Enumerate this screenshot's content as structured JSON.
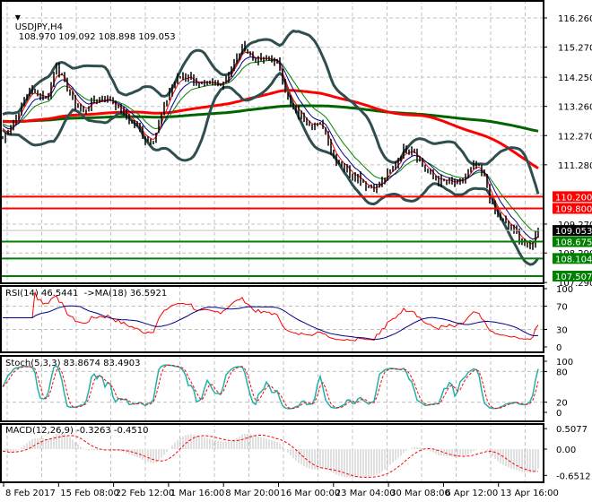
{
  "header": {
    "symbol": "USDJPY,H4",
    "ohlc": "108.970 109.092 108.898 109.053"
  },
  "chart_data": {
    "type": "line",
    "title": "USDJPY,H4 108.970 109.092 108.898 109.053",
    "price_ticks": [
      "116.260",
      "115.270",
      "114.250",
      "113.260",
      "112.270",
      "111.280",
      "109.270",
      "108.290",
      "107.290"
    ],
    "ylim": [
      107.0,
      116.6
    ],
    "time_ticks": [
      "8 Feb 2017",
      "15 Feb 08:00",
      "22 Feb 12:00",
      "1 Mar 16:00",
      "8 Mar 20:00",
      "16 Mar 00:00",
      "23 Mar 04:00",
      "30 Mar 08:00",
      "6 Apr 12:00",
      "13 Apr 16:00"
    ],
    "close_approx": [
      112.16,
      112.6,
      113.2,
      113.83,
      113.7,
      113.52,
      114.74,
      114.0,
      113.4,
      113.07,
      113.4,
      113.52,
      113.52,
      113.2,
      112.9,
      112.6,
      112.15,
      112.2,
      113.2,
      114.0,
      114.3,
      114.3,
      113.98,
      113.98,
      113.98,
      114.2,
      114.74,
      115.35,
      114.9,
      114.8,
      114.9,
      114.6,
      113.4,
      113.0,
      112.8,
      112.6,
      112.6,
      111.6,
      111.3,
      111.0,
      110.85,
      110.5,
      110.5,
      110.9,
      111.3,
      111.85,
      111.85,
      111.3,
      110.9,
      110.7,
      110.7,
      110.6,
      110.9,
      111.3,
      110.8,
      109.73,
      109.4,
      109.1,
      108.8,
      108.4,
      109.05
    ],
    "current_price": "109.053",
    "levels": [
      {
        "price": 110.2,
        "label": "110.200",
        "color": "#ff0000"
      },
      {
        "price": 109.8,
        "label": "109.800",
        "color": "#ff0000"
      },
      {
        "price": 108.675,
        "label": "108.675",
        "color": "#008000"
      },
      {
        "price": 108.104,
        "label": "108.104",
        "color": "#008000"
      },
      {
        "price": 107.507,
        "label": "107.507",
        "color": "#008000"
      }
    ],
    "grid": true,
    "indicators": {
      "rsi": {
        "label": "RSI(14) 46.5441  ->MA(18) 36.5921",
        "ticks": [
          "100",
          "70",
          "30",
          "0"
        ]
      },
      "stoch": {
        "label": "Stoch(5,3,3) 83.8674 83.4903",
        "ticks": [
          "100",
          "80",
          "20",
          "0"
        ]
      },
      "macd": {
        "label": "MACD(12,26,9) -0.3263 -0.4510",
        "ticks": [
          "0.5077",
          "0.00",
          "-0.6512"
        ]
      }
    },
    "colors": {
      "bars": "#000000",
      "bb": "#2f4f4f",
      "ma_fast_red": "#ff0000",
      "ma_slow_green": "#006400",
      "rsi": "#ff0000",
      "rsi_ma": "#00008b",
      "stoch_main": "#20b2aa",
      "stoch_signal": "#ff0000",
      "macd_hist": "#c0c0c0",
      "macd_signal": "#ff0000"
    }
  }
}
